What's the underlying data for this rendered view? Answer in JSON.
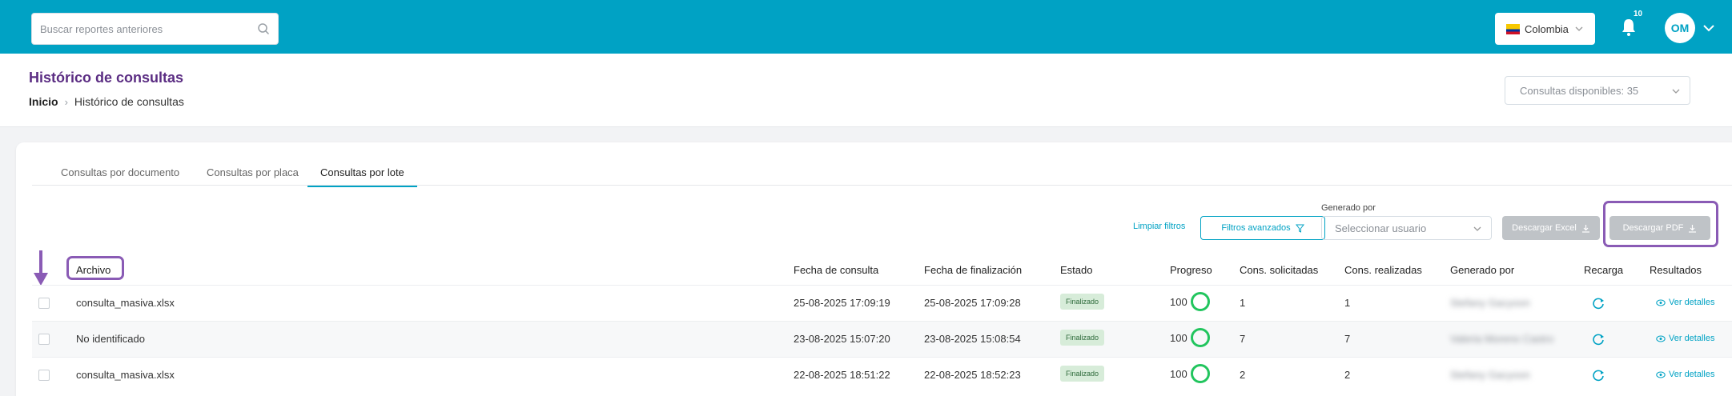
{
  "search": {
    "placeholder": "Buscar reportes anteriores"
  },
  "country": {
    "label": "Colombia"
  },
  "notifications": {
    "count": "10"
  },
  "user": {
    "initials": "OM"
  },
  "header": {
    "title": "Histórico de consultas",
    "breadcrumb": {
      "home": "Inicio",
      "current": "Histórico de consultas"
    },
    "quota": "Consultas disponibles: 35"
  },
  "tabs": [
    {
      "label": "Consultas por documento",
      "active": false
    },
    {
      "label": "Consultas por placa",
      "active": false
    },
    {
      "label": "Consultas por lote",
      "active": true
    }
  ],
  "filters": {
    "clear": "Limpiar filtros",
    "advanced": "Filtros avanzados",
    "generated_by_label": "Generado por",
    "user_select_placeholder": "Seleccionar usuario",
    "download_excel": "Descargar Excel",
    "download_pdf": "Descargar PDF"
  },
  "table": {
    "headers": {
      "archivo": "Archivo",
      "fecha_consulta": "Fecha de consulta",
      "fecha_fin": "Fecha de finalización",
      "estado": "Estado",
      "progreso": "Progreso",
      "solicitadas": "Cons. solicitadas",
      "realizadas": "Cons. realizadas",
      "generado": "Generado por",
      "recarga": "Recarga",
      "resultados": "Resultados"
    },
    "rows": [
      {
        "archivo": "consulta_masiva.xlsx",
        "fecha_consulta": "25-08-2025 17:09:19",
        "fecha_fin": "25-08-2025 17:09:28",
        "estado": "Finalizado",
        "progreso": "100",
        "solicitadas": "1",
        "realizadas": "1",
        "generado": "Stefany Gacyoon",
        "resultados": "Ver detalles"
      },
      {
        "archivo": "No identificado",
        "fecha_consulta": "23-08-2025 15:07:20",
        "fecha_fin": "23-08-2025 15:08:54",
        "estado": "Finalizado",
        "progreso": "100",
        "solicitadas": "7",
        "realizadas": "7",
        "generado": "Valeria Moreno Castro",
        "resultados": "Ver detalles"
      },
      {
        "archivo": "consulta_masiva.xlsx",
        "fecha_consulta": "22-08-2025 18:51:22",
        "fecha_fin": "22-08-2025 18:52:23",
        "estado": "Finalizado",
        "progreso": "100",
        "solicitadas": "2",
        "realizadas": "2",
        "generado": "Stefany Gacyoon",
        "resultados": "Ver detalles"
      }
    ]
  },
  "colors": {
    "brand": "#00a2c4",
    "title": "#5b2d83",
    "highlight": "#8a5bb5",
    "progress": "#22c55e"
  }
}
